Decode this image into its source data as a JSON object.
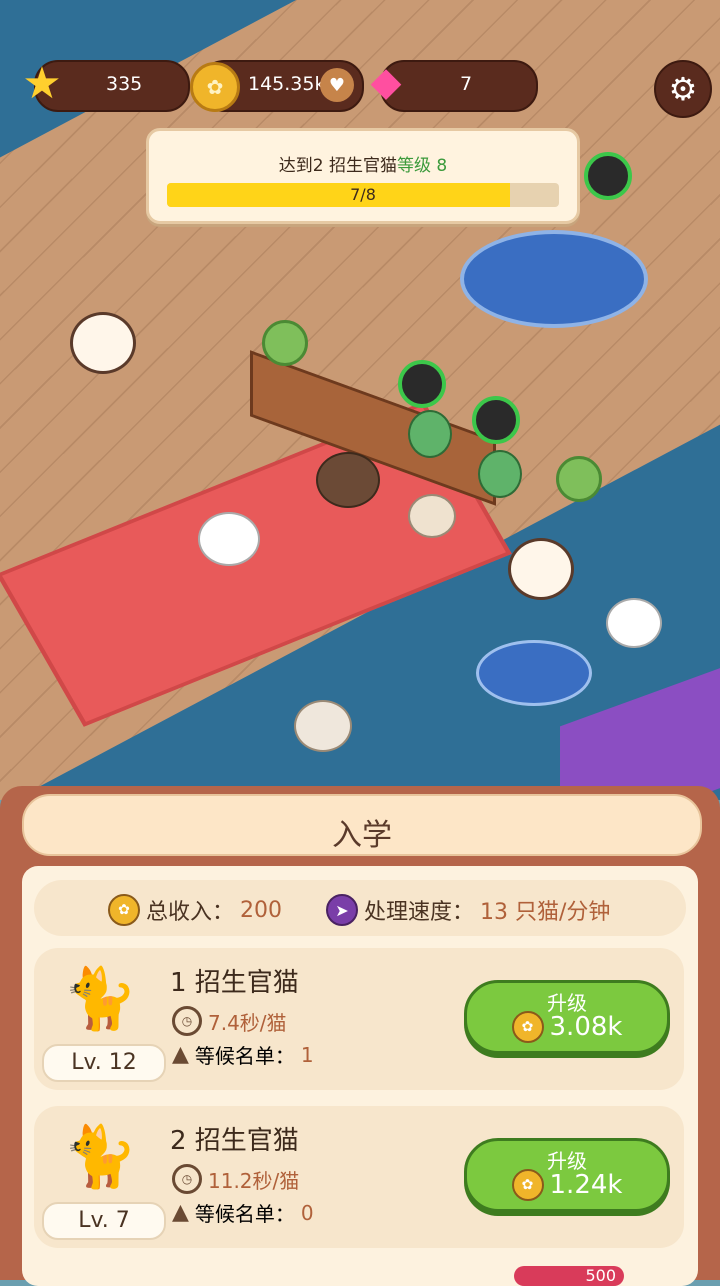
{
  "hud": {
    "stars": "335",
    "coins": "145.35k",
    "gems": "7"
  },
  "goal": {
    "prefix": "达到2 招生官猫",
    "level_text": "等级 8",
    "progress_label": "7/8",
    "progress_fraction": 0.875
  },
  "panel": {
    "title": "入学",
    "stats": {
      "income_label": "总收入：",
      "income_value": "200",
      "speed_label": "处理速度：",
      "speed_value": "13 只猫/分钟"
    },
    "cards": [
      {
        "name": "1 招生官猫",
        "time": "7.4秒/猫",
        "waitlist_label": "等候名单：",
        "waitlist_value": "1",
        "level": "Lv. 12",
        "upgrade_label": "升级",
        "upgrade_cost": "3.08k"
      },
      {
        "name": "2 招生官猫",
        "time": "11.2秒/猫",
        "waitlist_label": "等候名单：",
        "waitlist_value": "0",
        "level": "Lv. 7",
        "upgrade_label": "升级",
        "upgrade_cost": "1.24k"
      }
    ],
    "peek_badge": "500"
  }
}
